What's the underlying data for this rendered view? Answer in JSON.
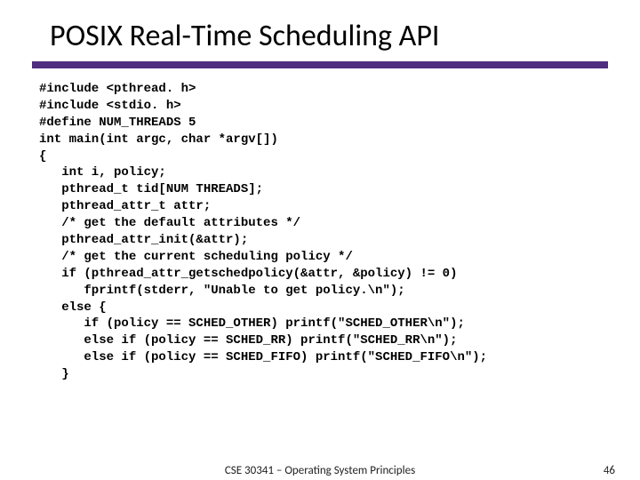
{
  "title": "POSIX Real-Time Scheduling API",
  "code_lines": [
    "#include <pthread. h>",
    "#include <stdio. h>",
    "#define NUM_THREADS 5",
    "int main(int argc, char *argv[])",
    "{",
    "   int i, policy;",
    "   pthread_t tid[NUM THREADS];",
    "   pthread_attr_t attr;",
    "   /* get the default attributes */",
    "   pthread_attr_init(&attr);",
    "   /* get the current scheduling policy */",
    "   if (pthread_attr_getschedpolicy(&attr, &policy) != 0)",
    "      fprintf(stderr, \"Unable to get policy.\\n\");",
    "   else {",
    "      if (policy == SCHED_OTHER) printf(\"SCHED_OTHER\\n\");",
    "      else if (policy == SCHED_RR) printf(\"SCHED_RR\\n\");",
    "      else if (policy == SCHED_FIFO) printf(\"SCHED_FIFO\\n\");",
    "   }"
  ],
  "footer_center": "CSE 30341 – Operating System Principles",
  "footer_right": "46"
}
